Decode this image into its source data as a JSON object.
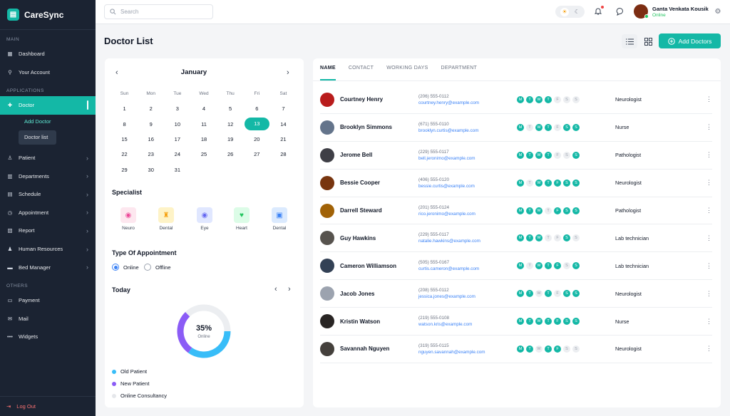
{
  "app": {
    "name": "CareSync"
  },
  "sidebar": {
    "sections": {
      "main": "MAIN",
      "applications": "APPLICATIONS",
      "others": "OTHERS"
    },
    "items": [
      {
        "label": "Dashboard"
      },
      {
        "label": "Your Account"
      },
      {
        "label": "Doctor"
      },
      {
        "label": "Patient"
      },
      {
        "label": "Departments"
      },
      {
        "label": "Schedule"
      },
      {
        "label": "Appointment"
      },
      {
        "label": "Report"
      },
      {
        "label": "Human Resources"
      },
      {
        "label": "Bed Manager"
      },
      {
        "label": "Payment"
      },
      {
        "label": "Mail"
      },
      {
        "label": "Widgets"
      }
    ],
    "sub": {
      "add": "Add Doctor",
      "list": "Doctor list"
    },
    "logout": "Log Out"
  },
  "topbar": {
    "search_placeholder": "Search",
    "user_name": "Ganta Venkata Kousik",
    "user_status": "Online"
  },
  "page": {
    "title": "Doctor List",
    "add_button": "Add Doctors"
  },
  "calendar": {
    "month": "January",
    "weekdays": [
      "Sun",
      "Mon",
      "Tue",
      "Wed",
      "Thu",
      "Fri",
      "Sat"
    ],
    "weeks": [
      [
        "1",
        "2",
        "3",
        "4",
        "5",
        "6",
        "7"
      ],
      [
        "8",
        "9",
        "10",
        "11",
        "12",
        "13",
        "14"
      ],
      [
        "15",
        "16",
        "17",
        "18",
        "19",
        "20",
        "21"
      ],
      [
        "22",
        "23",
        "24",
        "25",
        "26",
        "27",
        "28"
      ],
      [
        "29",
        "30",
        "31",
        "",
        "",
        "",
        ""
      ]
    ],
    "selected": "13"
  },
  "specialist": {
    "title": "Specialist",
    "items": [
      {
        "label": "Neuro",
        "icon": "neuro-icon",
        "bg": "#fde7ef",
        "fg": "#ec4899"
      },
      {
        "label": "Dental",
        "icon": "tooth-icon",
        "bg": "#fef3c7",
        "fg": "#f59e0b"
      },
      {
        "label": "Eye",
        "icon": "eye-icon",
        "bg": "#e0e7ff",
        "fg": "#6366f1"
      },
      {
        "label": "Heart",
        "icon": "heart-icon",
        "bg": "#dcfce7",
        "fg": "#22c55e"
      },
      {
        "label": "Dental",
        "icon": "hospital-icon",
        "bg": "#dbeafe",
        "fg": "#3b82f6"
      }
    ]
  },
  "appointment": {
    "title": "Type Of Appointment",
    "options": [
      "Online",
      "Offline"
    ],
    "selected": "Online"
  },
  "today": {
    "title": "Today",
    "percent": "35%",
    "percent_value": 35,
    "center_label": "Online",
    "legend": [
      {
        "label": "Old Patient",
        "color": "#38bdf8"
      },
      {
        "label": "New Patient",
        "color": "#8b5cf6"
      },
      {
        "label": "Online Consultancy",
        "color": "#e5e7eb"
      }
    ]
  },
  "table": {
    "tabs": [
      "NAME",
      "CONTACT",
      "WORKING DAYS",
      "DEPARTMENT"
    ],
    "day_letters": [
      "M",
      "T",
      "W",
      "T",
      "F",
      "S",
      "S"
    ],
    "rows": [
      {
        "name": "Courtney Henry",
        "phone": "(206) 555-0112",
        "email": "courtney.henry@example.com",
        "days": [
          1,
          1,
          1,
          1,
          0,
          0,
          0
        ],
        "dept": "Neurologist",
        "avatar": "#b91c1c"
      },
      {
        "name": "Brooklyn Simmons",
        "phone": "(671) 555-0110",
        "email": "brooklyn.curtis@example.com",
        "days": [
          1,
          0,
          1,
          1,
          0,
          1,
          1
        ],
        "dept": "Nurse",
        "avatar": "#64748b"
      },
      {
        "name": "Jerome Bell",
        "phone": "(229) 555-0117",
        "email": "bell.jeronimo@example.com",
        "days": [
          1,
          1,
          1,
          1,
          0,
          0,
          1
        ],
        "dept": "Pathologist",
        "avatar": "#3f3f46"
      },
      {
        "name": "Bessie Cooper",
        "phone": "(406) 555-0120",
        "email": "bessie.curtis@example.com",
        "days": [
          1,
          0,
          1,
          1,
          1,
          1,
          1
        ],
        "dept": "Neurologist",
        "avatar": "#78350f"
      },
      {
        "name": "Darrell Steward",
        "phone": "(201) 555-0124",
        "email": "rico.jeronimo@example.com",
        "days": [
          1,
          1,
          1,
          0,
          1,
          1,
          1
        ],
        "dept": "Pathologist",
        "avatar": "#a16207"
      },
      {
        "name": "Guy Hawkins",
        "phone": "(229) 555-0117",
        "email": "natalie.hawkins@example.com",
        "days": [
          1,
          1,
          1,
          0,
          0,
          1,
          0
        ],
        "dept": "Lab technician",
        "avatar": "#57534e"
      },
      {
        "name": "Cameron Williamson",
        "phone": "(505) 555-0167",
        "email": "curtis.cameron@example.com",
        "days": [
          1,
          0,
          1,
          1,
          1,
          0,
          1
        ],
        "dept": "Lab technician",
        "avatar": "#334155"
      },
      {
        "name": "Jacob Jones",
        "phone": "(208) 555-0112",
        "email": "jessica.jones@example.com",
        "days": [
          1,
          1,
          0,
          1,
          0,
          1,
          1
        ],
        "dept": "Neurologist",
        "avatar": "#9ca3af"
      },
      {
        "name": "Kristin Watson",
        "phone": "(219) 555-0108",
        "email": "watson.kris@example.com",
        "days": [
          1,
          1,
          1,
          1,
          1,
          1,
          1
        ],
        "dept": "Nurse",
        "avatar": "#292524"
      },
      {
        "name": "Savannah Nguyen",
        "phone": "(319) 555-0115",
        "email": "nguyen.savannah@example.com",
        "days": [
          1,
          1,
          0,
          1,
          1,
          0,
          0
        ],
        "dept": "Neurologist",
        "avatar": "#44403c"
      }
    ]
  }
}
